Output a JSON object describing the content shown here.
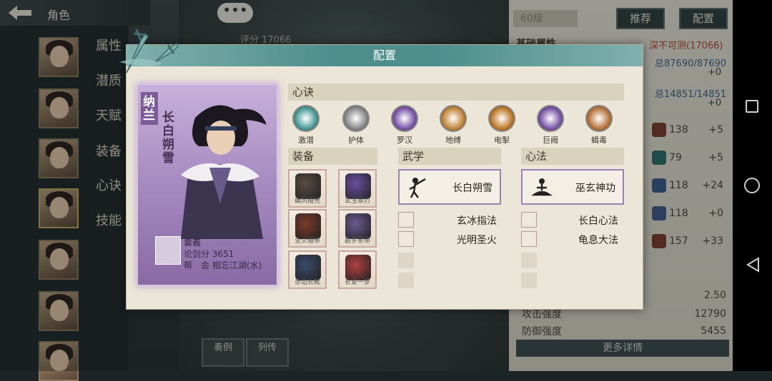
{
  "topbar": {
    "title": "角色"
  },
  "sidebar": {
    "tabs": [
      "属性",
      "潜质",
      "天赋",
      "装备",
      "心诀",
      "技能"
    ]
  },
  "background": {
    "chat_bubble": "•••",
    "score_label": "评分 17066",
    "level": "60级",
    "recommend_button": "推荐",
    "config_button": "配置",
    "basic_attr_heading": "基础属性",
    "unfathomable": "深不可测(17066)",
    "line1": "总87690/87690",
    "line1_plus": "+0",
    "line2": "总14851/14851",
    "line2_plus": "+0",
    "stats": [
      {
        "icon": "stat-icon",
        "value": "138",
        "plus": "+5"
      },
      {
        "icon": "stat-icon",
        "value": "79",
        "plus": "+5"
      },
      {
        "icon": "stat-icon",
        "value": "118",
        "plus": "+24"
      },
      {
        "icon": "stat-icon",
        "value": "118",
        "plus": "+0"
      },
      {
        "icon": "stat-icon",
        "value": "157",
        "plus": "+33"
      }
    ],
    "misc_value": "2.50",
    "attack_label": "攻击强度",
    "attack_value": "12790",
    "defense_label": "防御强度",
    "defense_value": "5455",
    "more_details": "更多详情",
    "bottom_btn1": "奏例",
    "bottom_btn2": "列传"
  },
  "dialog": {
    "title": "配置",
    "card": {
      "clan": "纳兰",
      "hero_title": "长白朔雪",
      "player_name": "囊義",
      "sword_score": "论剑分 3651",
      "guild": "帮　会 相忘江湖(水)"
    },
    "xinjue": {
      "heading": "心诀",
      "items": [
        {
          "label": "激潜",
          "color": "#4a9b97"
        },
        {
          "label": "护体",
          "color": "#8a8a8a"
        },
        {
          "label": "罗汉",
          "color": "#7a55a8"
        },
        {
          "label": "地缚",
          "color": "#c2873a"
        },
        {
          "label": "电掣",
          "color": "#c07a2a"
        },
        {
          "label": "巨阙",
          "color": "#7a55a8"
        },
        {
          "label": "蝎毒",
          "color": "#b9743a"
        }
      ]
    },
    "equip": {
      "heading": "装备",
      "items": [
        {
          "name": "幽风檀兜",
          "color": "#5a4a44"
        },
        {
          "name": "玄玉寒刃",
          "color": "#6a4ea0"
        },
        {
          "name": "业火缠带",
          "color": "#7a3a2a"
        },
        {
          "name": "碧罗系带",
          "color": "#6a5a90"
        },
        {
          "name": "赤焰长靴",
          "color": "#3a4a6a"
        },
        {
          "name": "长安一梦",
          "color": "#b04040"
        }
      ]
    },
    "wuxue": {
      "heading": "武学",
      "main": "长白朔雪",
      "subs": [
        "玄冰指法",
        "光明圣火"
      ]
    },
    "xinfa": {
      "heading": "心法",
      "main": "巫玄神功",
      "subs": [
        "长白心法",
        "龟息大法"
      ]
    }
  }
}
